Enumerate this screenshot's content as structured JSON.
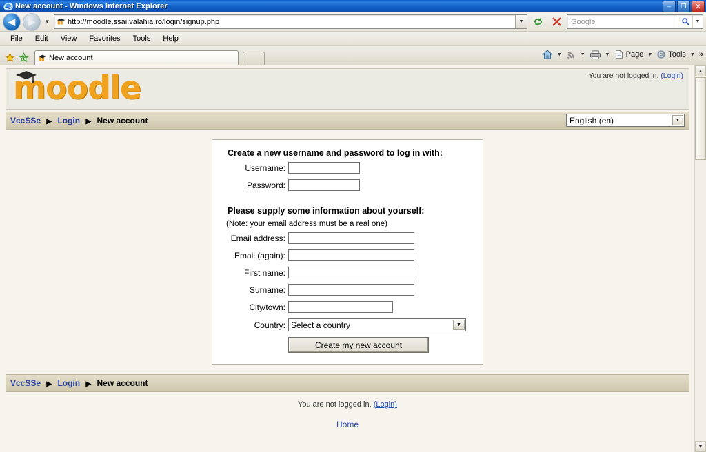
{
  "window": {
    "title": "New account - Windows Internet Explorer",
    "minimize_label": "–",
    "restore_label": "❐",
    "close_label": "✕"
  },
  "browser": {
    "back_label": "◀",
    "forward_label": "▶",
    "history_caret": "▼",
    "url": "http://moodle.ssai.valahia.ro/login/signup.php",
    "url_dropdown_caret": "▼",
    "refresh_label": "↺",
    "stop_label": "✕",
    "search_placeholder": "Google",
    "search_go_label": "⚲",
    "search_caret": "▼",
    "menu": [
      "File",
      "Edit",
      "View",
      "Favorites",
      "Tools",
      "Help"
    ],
    "tab_title": "New account",
    "newtab_label": "",
    "command_bar": {
      "home_caret": "▼",
      "feeds_caret": "▼",
      "print_caret": "▼",
      "page_label": "Page",
      "page_caret": "▼",
      "tools_label": "Tools",
      "tools_caret": "▼",
      "overflow_label": "»"
    }
  },
  "scrollbar": {
    "up_arrow": "▲",
    "down_arrow": "▼"
  },
  "site": {
    "logo_text": "moodle",
    "login_status": "You are not logged in.",
    "login_link": "(Login)",
    "language": "English (en)",
    "language_caret": "▼"
  },
  "breadcrumb": {
    "home": "VccSSe",
    "sep": "▶",
    "login": "Login",
    "current": "New account"
  },
  "form": {
    "heading_credentials": "Create a new username and password to log in with:",
    "heading_info": "Please supply some information about yourself:",
    "note": "(Note: your email address must be a real one)",
    "fields": [
      {
        "label": "Username:",
        "value": "",
        "width": "short"
      },
      {
        "label": "Password:",
        "value": "",
        "width": "short"
      },
      {
        "label": "Email address:",
        "value": "",
        "width": "long"
      },
      {
        "label": "Email (again):",
        "value": "",
        "width": "long"
      },
      {
        "label": "First name:",
        "value": "",
        "width": "long"
      },
      {
        "label": "Surname:",
        "value": "",
        "width": "long"
      },
      {
        "label": "City/town:",
        "value": "",
        "width": "city"
      }
    ],
    "country_label": "Country:",
    "country_value": "Select a country",
    "country_caret": "▼",
    "submit_label": "Create my new account"
  },
  "footer": {
    "login_status": "You are not logged in.",
    "login_link": "(Login)",
    "home_link": "Home"
  },
  "colors": {
    "titlebar_blue": "#1361c9",
    "moodle_orange": "#f0a11e",
    "link_blue": "#2a4bbd",
    "nav_tan": "#cfc7ad",
    "page_bg": "#f7f4ee"
  }
}
